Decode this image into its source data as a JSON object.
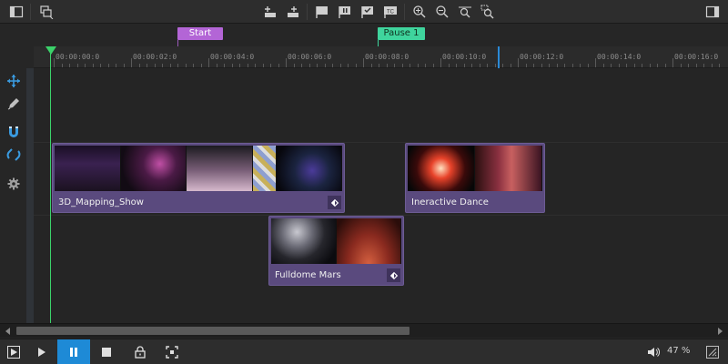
{
  "markers": {
    "start": "Start",
    "pause": "Pause 1"
  },
  "ruler": {
    "labels": [
      "00:00:00:0",
      "00:00:02:0",
      "00:00:04:0",
      "00:00:06:0",
      "00:00:08:0",
      "00:00:10:0",
      "00:00:12:0",
      "00:00:14:0",
      "00:00:16:0"
    ]
  },
  "clips": [
    {
      "name": "3D_Mapping_Show"
    },
    {
      "name": "Ineractive Dance"
    },
    {
      "name": "Fulldome Mars"
    }
  ],
  "statusbar": {
    "zoom": "47 %"
  },
  "colors": {
    "playhead": "#3bd26a",
    "clip": "#5a4a7e",
    "start_marker": "#b365d6",
    "pause_marker": "#3fd49d",
    "accent": "#1e8ad6"
  },
  "icons": {
    "toolbar": [
      "panel-left-icon",
      "copy-icon",
      "add-track-icon",
      "remove-track-icon",
      "flag-icon",
      "pause-marker-icon",
      "checkmark-flag-icon",
      "timecode-icon",
      "zoom-in-icon",
      "zoom-out-icon",
      "zoom-fit-icon",
      "zoom-selection-icon",
      "panel-right-icon"
    ],
    "tools": [
      "move-icon",
      "pencil-icon",
      "magnet-icon",
      "link-icon",
      "gear-icon"
    ],
    "transport": [
      "play-from-start-icon",
      "play-icon",
      "pause-icon",
      "stop-icon",
      "lock-icon",
      "fullscreen-icon",
      "volume-icon",
      "resize-icon"
    ]
  }
}
